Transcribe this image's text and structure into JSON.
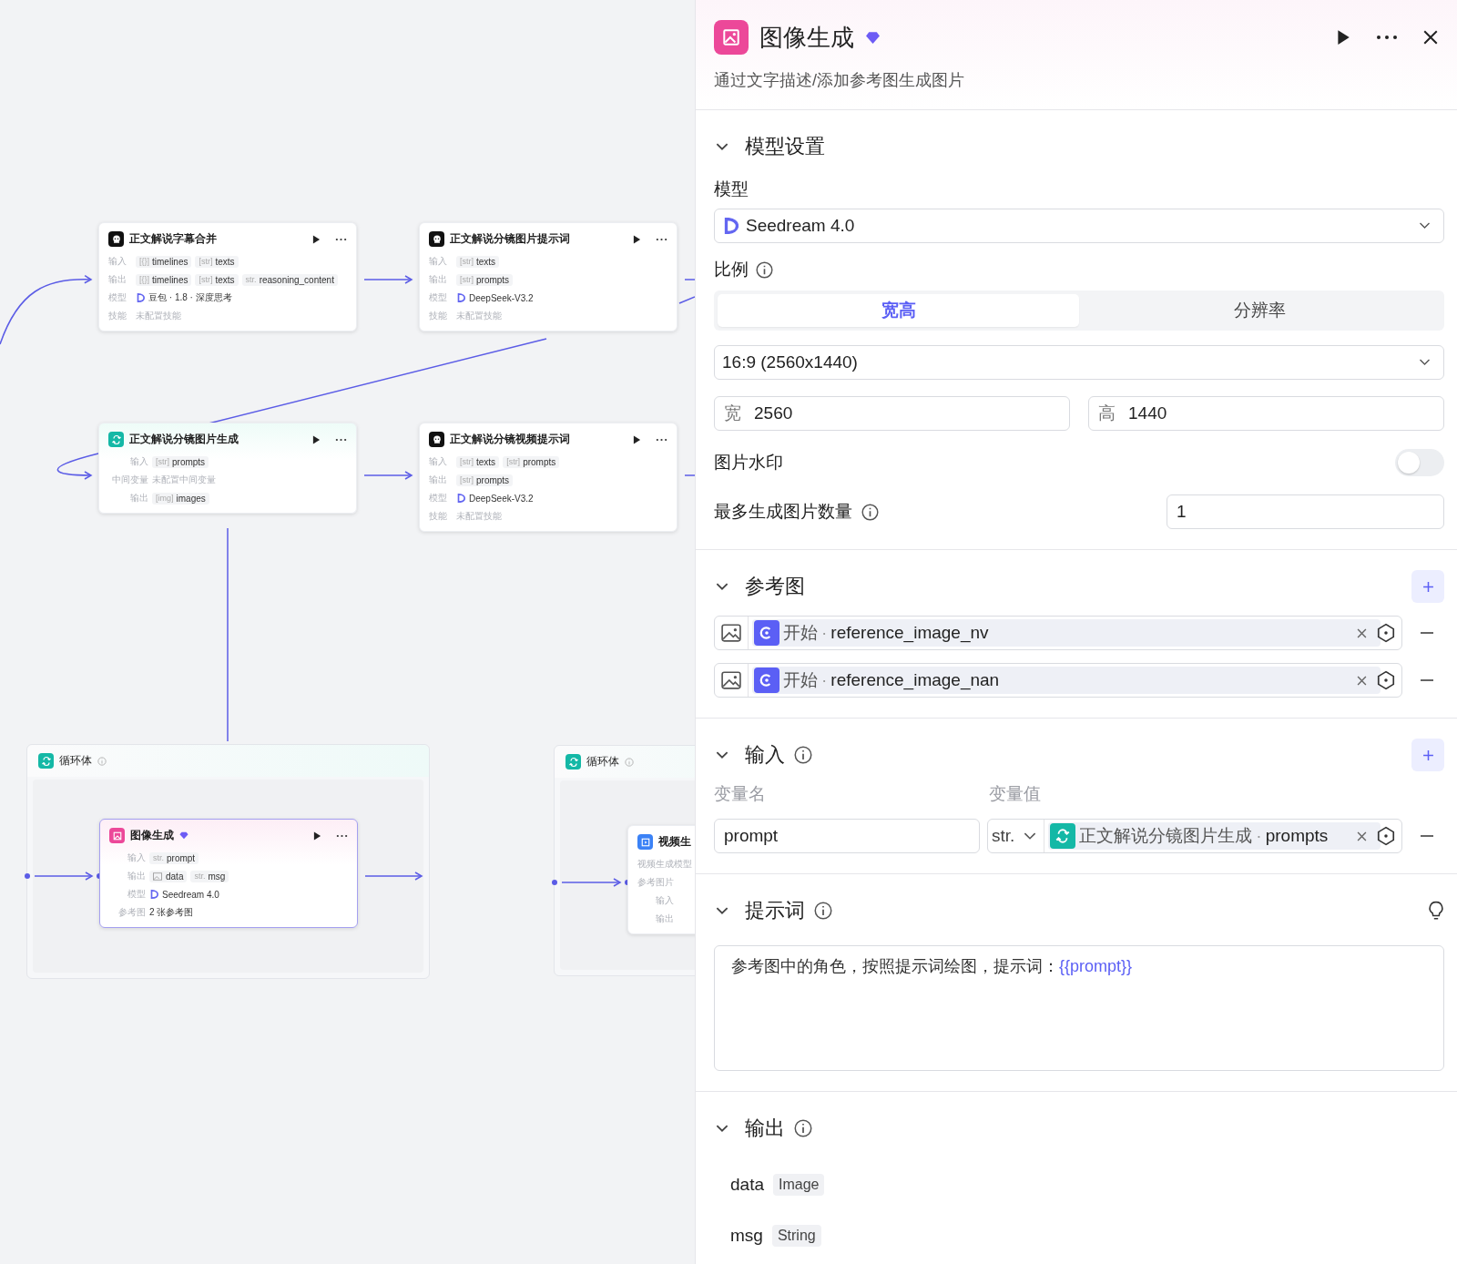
{
  "canvas": {
    "nodes": [
      {
        "kind": "llm",
        "title": "正文解说字幕合并",
        "rows": [
          {
            "kind": "tags",
            "label": "输入",
            "tags": [
              {
                "prefix": "[{}]",
                "text": "timelines"
              },
              {
                "prefix": "[str]",
                "text": "texts"
              }
            ]
          },
          {
            "kind": "tags",
            "label": "输出",
            "tags": [
              {
                "prefix": "[{}]",
                "text": "timelines"
              },
              {
                "prefix": "[str]",
                "text": "texts"
              },
              {
                "prefix": "str.",
                "text": "reasoning_content"
              }
            ]
          },
          {
            "kind": "model",
            "label": "模型",
            "text": "豆包 · 1.8 · 深度思考"
          },
          {
            "kind": "empty",
            "label": "技能",
            "text": "未配置技能"
          }
        ]
      },
      {
        "kind": "llm",
        "title": "正文解说分镜图片提示词",
        "rows": [
          {
            "kind": "tags",
            "label": "输入",
            "tags": [
              {
                "prefix": "[str]",
                "text": "texts"
              }
            ]
          },
          {
            "kind": "tags",
            "label": "输出",
            "tags": [
              {
                "prefix": "[str]",
                "text": "prompts"
              }
            ]
          },
          {
            "kind": "model",
            "label": "模型",
            "text": "DeepSeek-V3.2"
          },
          {
            "kind": "empty",
            "label": "技能",
            "text": "未配置技能"
          }
        ]
      },
      {
        "kind": "loop",
        "title": "正文解说分镜图片生成",
        "rows": [
          {
            "kind": "tags",
            "label": "输入",
            "tags": [
              {
                "prefix": "[str]",
                "text": "prompts"
              }
            ]
          },
          {
            "kind": "empty",
            "label": "中间变量",
            "text": "未配置中间变量"
          },
          {
            "kind": "tags",
            "label": "输出",
            "tags": [
              {
                "prefix": "[img]",
                "text": "images"
              }
            ]
          }
        ]
      },
      {
        "kind": "llm",
        "title": "正文解说分镜视频提示词",
        "rows": [
          {
            "kind": "tags",
            "label": "输入",
            "tags": [
              {
                "prefix": "[str]",
                "text": "texts"
              },
              {
                "prefix": "[str]",
                "text": "prompts"
              }
            ]
          },
          {
            "kind": "tags",
            "label": "输出",
            "tags": [
              {
                "prefix": "[str]",
                "text": "prompts"
              }
            ]
          },
          {
            "kind": "model",
            "label": "模型",
            "text": "DeepSeek-V3.2"
          },
          {
            "kind": "empty",
            "label": "技能",
            "text": "未配置技能"
          }
        ]
      }
    ],
    "loops": [
      {
        "title": "循环体",
        "node": {
          "kind": "image",
          "title": "图像生成",
          "premium": true,
          "rows": [
            {
              "kind": "tags",
              "label": "输入",
              "tags": [
                {
                  "prefix": "str.",
                  "text": "prompt"
                }
              ]
            },
            {
              "kind": "tags",
              "label": "输出",
              "tags": [
                {
                  "kind": "image",
                  "text": "data"
                },
                {
                  "prefix": "str.",
                  "text": "msg"
                }
              ]
            },
            {
              "kind": "model",
              "label": "模型",
              "text": "Seedream 4.0"
            },
            {
              "kind": "text",
              "label": "参考图",
              "text": "2 张参考图"
            }
          ]
        }
      },
      {
        "title": "循环体",
        "node": {
          "kind": "video",
          "title": "视频生",
          "premium": false,
          "rows": [
            {
              "kind": "label",
              "label": "视频生成模型"
            },
            {
              "kind": "label",
              "label": "参考图片"
            },
            {
              "kind": "label",
              "label": "输入"
            },
            {
              "kind": "label",
              "label": "输出"
            }
          ]
        }
      }
    ]
  },
  "panel": {
    "title": "图像生成",
    "premium": true,
    "subtitle": "通过文字描述/添加参考图生成图片",
    "model_settings": {
      "title": "模型设置",
      "expanded": true,
      "model_label": "模型",
      "model": {
        "value": "Seedream 4.0"
      },
      "ratio_label": "比例",
      "ratio_tabs": [
        {
          "label": "宽高",
          "selected": true
        },
        {
          "label": "分辨率",
          "selected": false
        }
      ],
      "ratio_value": "16:9 (2560x1440)",
      "width": {
        "prefix": "宽",
        "value": "2560"
      },
      "height": {
        "prefix": "高",
        "value": "1440"
      },
      "watermark_label": "图片水印",
      "watermark_on": false,
      "max_label": "最多生成图片数量",
      "max_value": "1"
    },
    "reference": {
      "title": "参考图",
      "expanded": true,
      "rows": [
        {
          "source": "开始",
          "separator": "·",
          "variable": "reference_image_nv"
        },
        {
          "source": "开始",
          "separator": "·",
          "variable": "reference_image_nan"
        }
      ]
    },
    "inputs": {
      "title": "输入",
      "expanded": true,
      "name_header": "变量名",
      "value_header": "变量值",
      "rows": [
        {
          "name": "prompt",
          "type": "str.",
          "source": "正文解说分镜图片生成",
          "separator": "·",
          "variable": "prompts"
        }
      ]
    },
    "prompt": {
      "title": "提示词",
      "expanded": true,
      "text": "参考图中的角色，按照提示词绘图，提示词：",
      "variable": "{{prompt}}"
    },
    "outputs": {
      "title": "输出",
      "expanded": true,
      "items": [
        {
          "name": "data",
          "type": "Image"
        },
        {
          "name": "msg",
          "type": "String"
        }
      ]
    }
  }
}
